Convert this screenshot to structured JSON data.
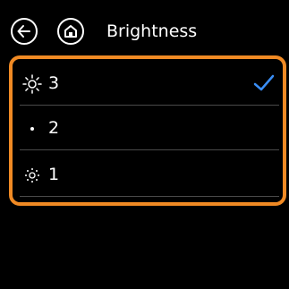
{
  "header": {
    "title": "Brightness",
    "back_icon": "back-arrow-icon",
    "home_icon": "home-icon"
  },
  "brightness_options": [
    {
      "label": "3",
      "icon": "brightness-high-icon",
      "selected": true
    },
    {
      "label": "2",
      "icon": "brightness-medium-icon",
      "selected": false
    },
    {
      "label": "1",
      "icon": "brightness-low-icon",
      "selected": false
    }
  ],
  "colors": {
    "background": "#000000",
    "accent": "#f08a24",
    "check": "#3a8ef6",
    "divider": "#4a4a4a",
    "text": "#ffffff"
  }
}
